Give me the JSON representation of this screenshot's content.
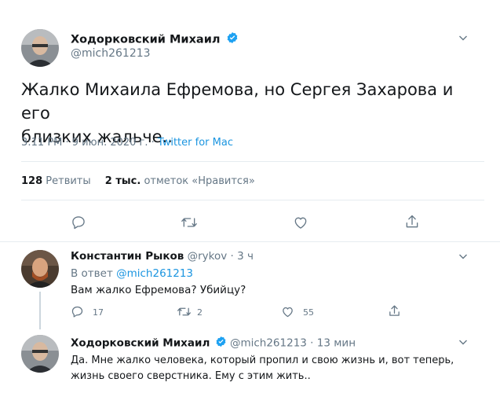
{
  "main_tweet": {
    "author_name": "Ходорковский Михаил",
    "handle": "@mich261213",
    "text_line1": "Жалко Михаила Ефремова, но Сергея Захарова и его",
    "text_line2": "близких жальче..",
    "time_date": "3:11 PM · 9 июн. 2020 г. · ",
    "source": "Twitter for Mac",
    "retweets_count": "128",
    "retweets_label": "Ретвиты",
    "likes_count": "2 тыс.",
    "likes_label": "отметок «Нравится»"
  },
  "reply_1": {
    "author_name": "Константин Рыков",
    "handle": "@rykov",
    "sep": "·",
    "time": "3 ч",
    "reply_to_prefix": "В ответ",
    "reply_to_handle": "@mich261213",
    "text": "Вам жалко Ефремова? Убийцу?",
    "replies": "17",
    "retweets": "2",
    "likes": "55"
  },
  "reply_2": {
    "author_name": "Ходорковский Михаил",
    "handle": "@mich261213",
    "sep": "·",
    "time": "13 мин",
    "text_line1": "Да. Мне жалко человека, который пропил и свою жизнь и, вот теперь,",
    "text_line2": "жизнь своего сверстника. Ему с этим жить.."
  },
  "colors": {
    "accent": "#1b95e0",
    "verified": "#1da1f2",
    "muted": "#657786",
    "divider": "#e6ecf0"
  },
  "icons": [
    "chevron-down-icon",
    "verified-badge-icon",
    "reply-icon",
    "retweet-icon",
    "like-icon",
    "share-icon"
  ]
}
